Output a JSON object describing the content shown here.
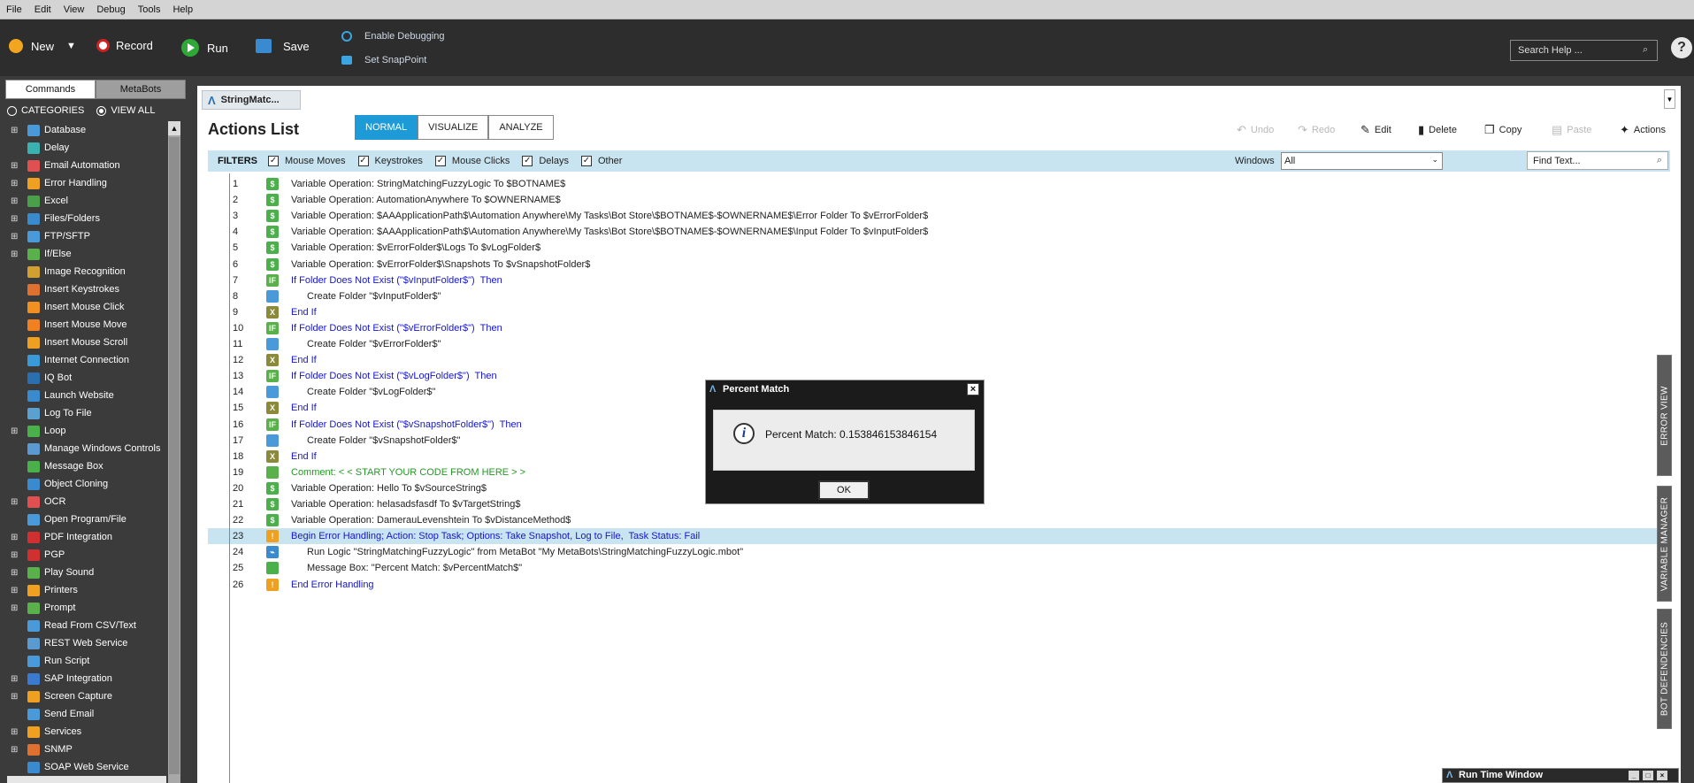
{
  "menu": [
    "File",
    "Edit",
    "View",
    "Debug",
    "Tools",
    "Help"
  ],
  "toolbar": {
    "new_label": "New",
    "record_label": "Record",
    "run_label": "Run",
    "save_label": "Save",
    "enable_debugging": "Enable Debugging",
    "set_snappoint": "Set SnapPoint",
    "search_placeholder": "Search Help ...",
    "help": "?"
  },
  "left": {
    "tabs": [
      "Commands",
      "MetaBots"
    ],
    "radio_categories": "CATEGORIES",
    "radio_viewall": "VIEW ALL",
    "commands": [
      {
        "label": "Database",
        "exp": true,
        "color": "#4a9ad9"
      },
      {
        "label": "Delay",
        "exp": false,
        "color": "#3ab0b0"
      },
      {
        "label": "Email Automation",
        "exp": true,
        "color": "#e05050"
      },
      {
        "label": "Error Handling",
        "exp": true,
        "color": "#f0a020"
      },
      {
        "label": "Excel",
        "exp": true,
        "color": "#4aa04a"
      },
      {
        "label": "Files/Folders",
        "exp": true,
        "color": "#3a8ad0"
      },
      {
        "label": "FTP/SFTP",
        "exp": true,
        "color": "#4a9ad9"
      },
      {
        "label": "If/Else",
        "exp": true,
        "color": "#5ab04a"
      },
      {
        "label": "Image Recognition",
        "exp": false,
        "color": "#d0a030"
      },
      {
        "label": "Insert Keystrokes",
        "exp": false,
        "color": "#e07030"
      },
      {
        "label": "Insert Mouse Click",
        "exp": false,
        "color": "#f09020"
      },
      {
        "label": "Insert Mouse Move",
        "exp": false,
        "color": "#f08020"
      },
      {
        "label": "Insert Mouse Scroll",
        "exp": false,
        "color": "#f0a020"
      },
      {
        "label": "Internet Connection",
        "exp": false,
        "color": "#3a9ad9"
      },
      {
        "label": "IQ Bot",
        "exp": false,
        "color": "#2a6fb0"
      },
      {
        "label": "Launch Website",
        "exp": false,
        "color": "#3a8ad0"
      },
      {
        "label": "Log To File",
        "exp": false,
        "color": "#5aa0d0"
      },
      {
        "label": "Loop",
        "exp": true,
        "color": "#4ab04a"
      },
      {
        "label": "Manage Windows Controls",
        "exp": false,
        "color": "#5a9ad0"
      },
      {
        "label": "Message Box",
        "exp": false,
        "color": "#4ab04a"
      },
      {
        "label": "Object Cloning",
        "exp": false,
        "color": "#3a8ad0"
      },
      {
        "label": "OCR",
        "exp": true,
        "color": "#e05050"
      },
      {
        "label": "Open Program/File",
        "exp": false,
        "color": "#4a9ad9"
      },
      {
        "label": "PDF Integration",
        "exp": true,
        "color": "#d03030"
      },
      {
        "label": "PGP",
        "exp": true,
        "color": "#d03030"
      },
      {
        "label": "Play Sound",
        "exp": true,
        "color": "#5ab04a"
      },
      {
        "label": "Printers",
        "exp": true,
        "color": "#f0a020"
      },
      {
        "label": "Prompt",
        "exp": true,
        "color": "#5ab04a"
      },
      {
        "label": "Read From CSV/Text",
        "exp": false,
        "color": "#4a9ad9"
      },
      {
        "label": "REST Web Service",
        "exp": false,
        "color": "#5a9ad0"
      },
      {
        "label": "Run Script",
        "exp": false,
        "color": "#4a9ad9"
      },
      {
        "label": "SAP Integration",
        "exp": true,
        "color": "#3a7ad0"
      },
      {
        "label": "Screen Capture",
        "exp": true,
        "color": "#f0a020"
      },
      {
        "label": "Send Email",
        "exp": false,
        "color": "#4a9ad9"
      },
      {
        "label": "Services",
        "exp": true,
        "color": "#f0a020"
      },
      {
        "label": "SNMP",
        "exp": true,
        "color": "#e07030"
      },
      {
        "label": "SOAP Web Service",
        "exp": false,
        "color": "#3a8ad0"
      }
    ]
  },
  "doc": {
    "tab_title": "StringMatc...",
    "title": "Actions List",
    "modes": [
      "NORMAL",
      "VISUALIZE",
      "ANALYZE"
    ],
    "undo": "Undo",
    "redo": "Redo",
    "edit": "Edit",
    "delete": "Delete",
    "copy": "Copy",
    "paste": "Paste",
    "actions": "Actions"
  },
  "filters": {
    "label": "FILTERS",
    "items": [
      "Mouse Moves",
      "Keystrokes",
      "Mouse Clicks",
      "Delays",
      "Other"
    ],
    "windows_label": "Windows",
    "windows_value": "All",
    "find_placeholder": "Find Text..."
  },
  "code_lines": [
    {
      "n": "1",
      "icon": "var",
      "indent": 0,
      "style": "",
      "text": "Variable Operation: StringMatchingFuzzyLogic To $BOTNAME$"
    },
    {
      "n": "2",
      "icon": "var",
      "indent": 0,
      "style": "",
      "text": "Variable Operation: AutomationAnywhere To $OWNERNAME$"
    },
    {
      "n": "3",
      "icon": "var",
      "indent": 0,
      "style": "",
      "text": "Variable Operation: $AAApplicationPath$\\Automation Anywhere\\My Tasks\\Bot Store\\$BOTNAME$-$OWNERNAME$\\Error Folder To $vErrorFolder$"
    },
    {
      "n": "4",
      "icon": "var",
      "indent": 0,
      "style": "",
      "text": "Variable Operation: $AAApplicationPath$\\Automation Anywhere\\My Tasks\\Bot Store\\$BOTNAME$-$OWNERNAME$\\Input Folder To $vInputFolder$"
    },
    {
      "n": "5",
      "icon": "var",
      "indent": 0,
      "style": "",
      "text": "Variable Operation: $vErrorFolder$\\Logs To $vLogFolder$"
    },
    {
      "n": "6",
      "icon": "var",
      "indent": 0,
      "style": "",
      "text": "Variable Operation: $vErrorFolder$\\Snapshots To $vSnapshotFolder$"
    },
    {
      "n": "7",
      "icon": "if",
      "indent": 0,
      "style": "blue",
      "text": "If Folder Does Not Exist (\"$vInputFolder$\")  Then"
    },
    {
      "n": "8",
      "icon": "folder",
      "indent": 1,
      "style": "",
      "text": "Create Folder \"$vInputFolder$\""
    },
    {
      "n": "9",
      "icon": "endif",
      "indent": 0,
      "style": "blue",
      "text": "End If"
    },
    {
      "n": "10",
      "icon": "if",
      "indent": 0,
      "style": "blue",
      "text": "If Folder Does Not Exist (\"$vErrorFolder$\")  Then"
    },
    {
      "n": "11",
      "icon": "folder",
      "indent": 1,
      "style": "",
      "text": "Create Folder \"$vErrorFolder$\""
    },
    {
      "n": "12",
      "icon": "endif",
      "indent": 0,
      "style": "blue",
      "text": "End If"
    },
    {
      "n": "13",
      "icon": "if",
      "indent": 0,
      "style": "blue",
      "text": "If Folder Does Not Exist (\"$vLogFolder$\")  Then"
    },
    {
      "n": "14",
      "icon": "folder",
      "indent": 1,
      "style": "",
      "text": "Create Folder \"$vLogFolder$\""
    },
    {
      "n": "15",
      "icon": "endif",
      "indent": 0,
      "style": "blue",
      "text": "End If"
    },
    {
      "n": "16",
      "icon": "if",
      "indent": 0,
      "style": "blue",
      "text": "If Folder Does Not Exist (\"$vSnapshotFolder$\")  Then"
    },
    {
      "n": "17",
      "icon": "folder",
      "indent": 1,
      "style": "",
      "text": "Create Folder \"$vSnapshotFolder$\""
    },
    {
      "n": "18",
      "icon": "endif",
      "indent": 0,
      "style": "blue",
      "text": "End If"
    },
    {
      "n": "19",
      "icon": "comment",
      "indent": 0,
      "style": "green",
      "text": "Comment: < < START YOUR CODE FROM HERE > >"
    },
    {
      "n": "20",
      "icon": "var",
      "indent": 0,
      "style": "",
      "text": "Variable Operation: Hello To $vSourceString$"
    },
    {
      "n": "21",
      "icon": "var",
      "indent": 0,
      "style": "",
      "text": "Variable Operation: helasadsfasdf To $vTargetString$"
    },
    {
      "n": "22",
      "icon": "var",
      "indent": 0,
      "style": "",
      "text": "Variable Operation: DamerauLevenshtein To $vDistanceMethod$"
    },
    {
      "n": "23",
      "icon": "warn",
      "indent": 0,
      "style": "blue",
      "text": "Begin Error Handling; Action: Stop Task; Options: Take Snapshot, Log to File,  Task Status: Fail",
      "selected": true
    },
    {
      "n": "24",
      "icon": "logic",
      "indent": 1,
      "style": "",
      "text": "Run Logic \"StringMatchingFuzzyLogic\" from MetaBot \"My MetaBots\\StringMatchingFuzzyLogic.mbot\""
    },
    {
      "n": "25",
      "icon": "msg",
      "indent": 1,
      "style": "",
      "text": "Message Box: \"Percent Match: $vPercentMatch$\""
    },
    {
      "n": "26",
      "icon": "warn",
      "indent": 0,
      "style": "blue",
      "text": "End Error Handling"
    }
  ],
  "side_tabs": [
    "ERROR VIEW",
    "VARIABLE MANAGER",
    "BOT DEFENDENCIES"
  ],
  "dialog": {
    "title": "Percent Match",
    "message": "Percent Match: 0.153846153846154",
    "ok": "OK"
  },
  "runtime_window": {
    "title": "Run Time Window"
  },
  "icons": {
    "var": {
      "color": "#4ab04a",
      "glyph": "$"
    },
    "if": {
      "color": "#5ab04a",
      "glyph": "IF"
    },
    "folder": {
      "color": "#4a9ad9",
      "glyph": ""
    },
    "endif": {
      "color": "#8a8a3a",
      "glyph": "X"
    },
    "comment": {
      "color": "#5ab04a",
      "glyph": ""
    },
    "warn": {
      "color": "#f0a020",
      "glyph": "!"
    },
    "logic": {
      "color": "#3a8ad0",
      "glyph": "⌁"
    },
    "msg": {
      "color": "#4ab04a",
      "glyph": ""
    }
  }
}
